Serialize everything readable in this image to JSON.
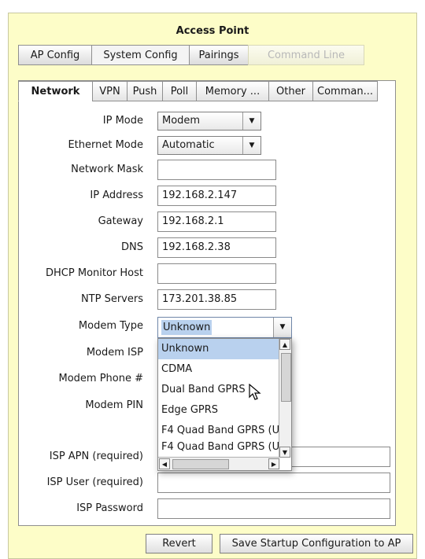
{
  "header": {
    "title": "Access Point"
  },
  "top_tabs": [
    {
      "label": "AP Config"
    },
    {
      "label": "System Config"
    },
    {
      "label": "Pairings"
    },
    {
      "label": "Command Line"
    }
  ],
  "sub_tabs": [
    {
      "label": "Network"
    },
    {
      "label": "VPN"
    },
    {
      "label": "Push"
    },
    {
      "label": "Poll"
    },
    {
      "label": "Memory ..."
    },
    {
      "label": "Other"
    },
    {
      "label": "Comman..."
    }
  ],
  "form": {
    "ip_mode": {
      "label": "IP Mode",
      "value": "Modem"
    },
    "ethernet_mode": {
      "label": "Ethernet Mode",
      "value": "Automatic"
    },
    "network_mask": {
      "label": "Network Mask",
      "value": ""
    },
    "ip_address": {
      "label": "IP Address",
      "value": "192.168.2.147"
    },
    "gateway": {
      "label": "Gateway",
      "value": "192.168.2.1"
    },
    "dns": {
      "label": "DNS",
      "value": "192.168.2.38"
    },
    "dhcp_monitor_host": {
      "label": "DHCP Monitor Host",
      "value": ""
    },
    "ntp_servers": {
      "label": "NTP Servers",
      "value": "173.201.38.85"
    },
    "modem_type": {
      "label": "Modem Type",
      "value": "Unknown"
    },
    "modem_isp": {
      "label": "Modem ISP"
    },
    "modem_phone": {
      "label": "Modem Phone #"
    },
    "modem_pin": {
      "label": "Modem PIN"
    },
    "isp_apn": {
      "label": "ISP APN (required)",
      "value": ""
    },
    "isp_user": {
      "label": "ISP User (required)",
      "value": ""
    },
    "isp_password": {
      "label": "ISP Password",
      "value": ""
    }
  },
  "modem_type_options": [
    "Unknown",
    "CDMA",
    "Dual Band GPRS",
    "Edge GPRS",
    "F4 Quad Band GPRS (U",
    "F4 Quad Band GPRS (U"
  ],
  "buttons": {
    "revert": "Revert",
    "save": "Save Startup Configuration to AP"
  },
  "icons": {
    "select_arrow": "chevron-down-icon",
    "scroll_up": "scroll-up-arrow-icon",
    "scroll_down": "scroll-down-arrow-icon",
    "scroll_left": "scroll-left-arrow-icon",
    "scroll_right": "scroll-right-arrow-icon",
    "cursor": "mouse-pointer-icon"
  },
  "colors": {
    "panel_bg": "#fdfdc8",
    "selection_bg": "#b9d1ee",
    "disabled_text": "#b8b8b8"
  }
}
